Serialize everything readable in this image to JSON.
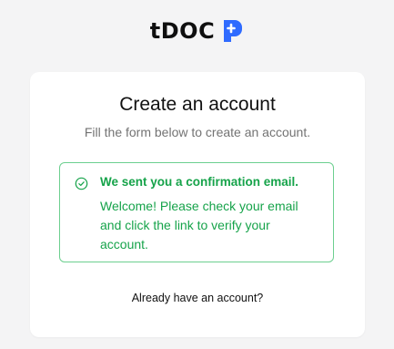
{
  "brand": {
    "name": "tDOC",
    "logo_icon": "tdoc-logo-icon",
    "logo_color": "#2f6bff"
  },
  "card": {
    "title": "Create an account",
    "subtitle": "Fill the form below to create an account."
  },
  "alert": {
    "icon": "check-circle-icon",
    "title": "We sent you a confirmation email.",
    "body": "Welcome! Please check your email and click the link to verify your account.",
    "color": "#16a34a"
  },
  "footer": {
    "signin_link": "Already have an account?"
  }
}
